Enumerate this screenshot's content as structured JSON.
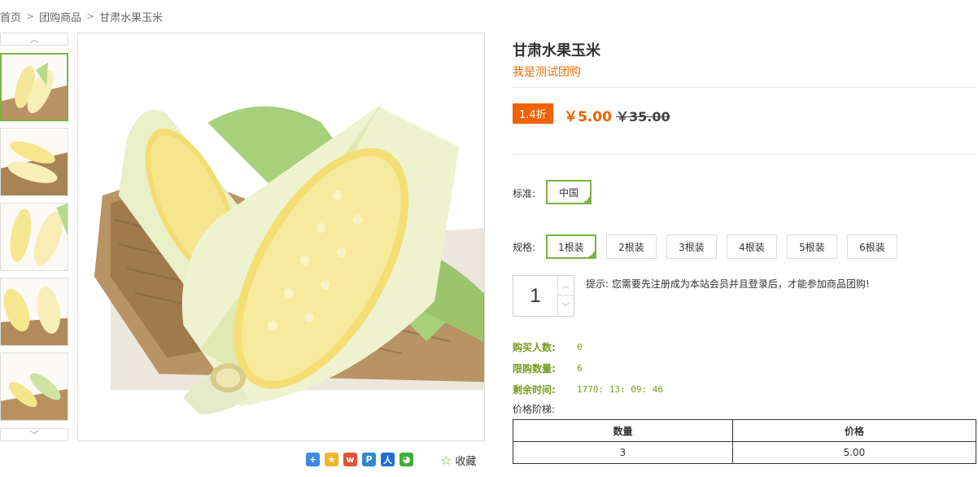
{
  "breadcrumb": [
    "首页",
    "团购商品",
    "甘肃水果玉米"
  ],
  "gallery": {
    "thumb_count": 5,
    "active_index": 0
  },
  "share": {
    "icons": [
      "plus-share-icon",
      "qzone-icon",
      "weibo-icon",
      "tencent-weibo-icon",
      "renren-icon",
      "wechat-icon"
    ],
    "favorite_label": "收藏"
  },
  "product": {
    "title": "甘肃水果玉米",
    "subtitle": "我是测试团购",
    "discount": "1.4折",
    "price": "￥5.00",
    "original_price": "￥35.00"
  },
  "options": {
    "standard_label": "标准:",
    "standard_values": [
      "中国"
    ],
    "spec_label": "规格:",
    "spec_values": [
      "1根装",
      "2根装",
      "3根装",
      "4根装",
      "5根装",
      "6根装"
    ],
    "spec_selected": 0
  },
  "quantity": {
    "value": "1"
  },
  "tip": "提示: 您需要先注册成为本站会员并且登录后，才能参加商品团购!",
  "stats": {
    "buyers_label": "购买人数:",
    "buyers_value": "0",
    "limit_label": "限购数量:",
    "limit_value": "6",
    "remaining_label": "剩余时间:",
    "remaining_value": "1770: 13: 09: 46"
  },
  "tiers": {
    "label": "价格阶梯:",
    "headers": [
      "数量",
      "价格"
    ],
    "rows": [
      [
        "3",
        "5.00"
      ]
    ]
  },
  "colors": {
    "accent_orange": "#f06100",
    "accent_green": "#7cb342",
    "stat_green": "#7a9a1e"
  }
}
